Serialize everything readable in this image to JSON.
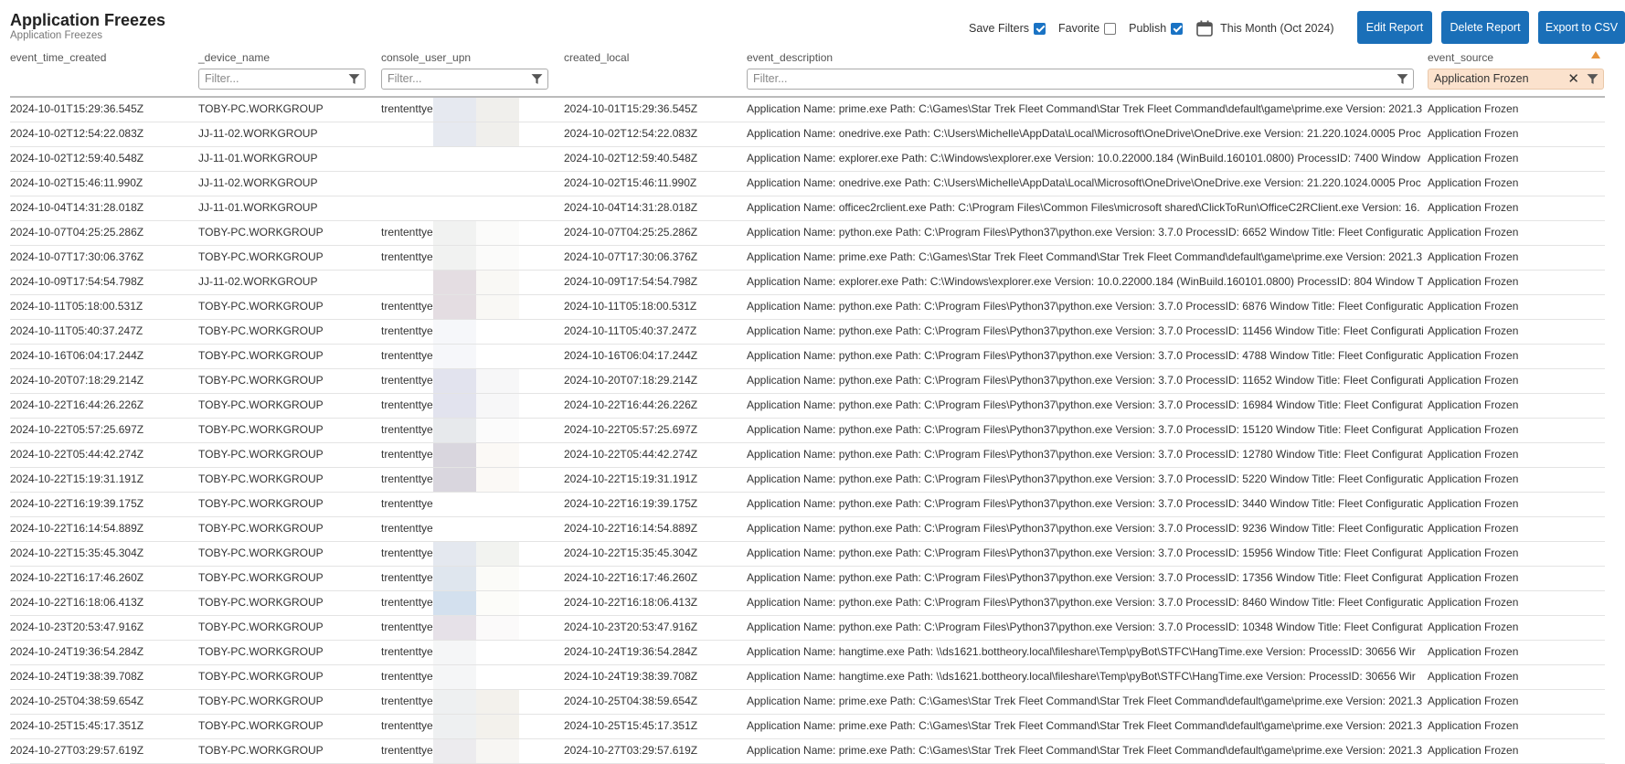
{
  "header": {
    "title": "Application Freezes",
    "subtitle": "Application Freezes"
  },
  "controls": {
    "save_filters_label": "Save Filters",
    "save_filters_checked": true,
    "favorite_label": "Favorite",
    "favorite_checked": false,
    "publish_label": "Publish",
    "publish_checked": true,
    "date_range_label": "This Month (Oct 2024)"
  },
  "buttons": {
    "edit_report": "Edit Report",
    "delete_report": "Delete Report",
    "export_csv": "Export to CSV"
  },
  "columns": {
    "event_time_created": "event_time_created",
    "device_name": "_device_name",
    "console_user_upn": "console_user_upn",
    "created_local": "created_local",
    "event_description": "event_description",
    "event_source": "event_source"
  },
  "filters": {
    "placeholder": "Filter...",
    "event_source_value": "Application Frozen"
  },
  "colors": {
    "accent": "#1a6fb8",
    "active_filter": "#fbe2cd",
    "sort_indicator": "#e8943a"
  },
  "rows": [
    {
      "time": "2024-10-01T15:29:36.545Z",
      "device": "TOBY-PC.WORKGROUP",
      "user": "trententtye",
      "local": "2024-10-01T15:29:36.545Z",
      "desc": "Application Name: prime.exe Path: C:\\Games\\Star Trek Fleet Command\\Star Trek Fleet Command\\default\\game\\prime.exe Version: 2021.3",
      "source": "Application Frozen",
      "r1": "#e6e9f0",
      "r2": "#f0efec"
    },
    {
      "time": "2024-10-02T12:54:22.083Z",
      "device": "JJ-11-02.WORKGROUP",
      "user": "",
      "local": "2024-10-02T12:54:22.083Z",
      "desc": "Application Name: onedrive.exe Path: C:\\Users\\Michelle\\AppData\\Local\\Microsoft\\OneDrive\\OneDrive.exe Version: 21.220.1024.0005 Proc",
      "source": "Application Frozen",
      "r1": "#e6e9f0",
      "r2": "#f0efec"
    },
    {
      "time": "2024-10-02T12:59:40.548Z",
      "device": "JJ-11-01.WORKGROUP",
      "user": "",
      "local": "2024-10-02T12:59:40.548Z",
      "desc": "Application Name: explorer.exe Path: C:\\Windows\\explorer.exe Version: 10.0.22000.184 (WinBuild.160101.0800) ProcessID: 7400 Window T",
      "source": "Application Frozen",
      "r1": "#ffffff",
      "r2": "#ffffff"
    },
    {
      "time": "2024-10-02T15:46:11.990Z",
      "device": "JJ-11-02.WORKGROUP",
      "user": "",
      "local": "2024-10-02T15:46:11.990Z",
      "desc": "Application Name: onedrive.exe Path: C:\\Users\\Michelle\\AppData\\Local\\Microsoft\\OneDrive\\OneDrive.exe Version: 21.220.1024.0005 Proc",
      "source": "Application Frozen",
      "r1": "#ffffff",
      "r2": "#ffffff"
    },
    {
      "time": "2024-10-04T14:31:28.018Z",
      "device": "JJ-11-01.WORKGROUP",
      "user": "",
      "local": "2024-10-04T14:31:28.018Z",
      "desc": "Application Name: officec2rclient.exe Path: C:\\Program Files\\Common Files\\microsoft shared\\ClickToRun\\OfficeC2RClient.exe Version: 16.",
      "source": "Application Frozen",
      "r1": "#ffffff",
      "r2": "#ffffff"
    },
    {
      "time": "2024-10-07T04:25:25.286Z",
      "device": "TOBY-PC.WORKGROUP",
      "user": "trententtye",
      "local": "2024-10-07T04:25:25.286Z",
      "desc": "Application Name: python.exe Path: C:\\Program Files\\Python37\\python.exe Version: 3.7.0 ProcessID: 6652 Window Title: Fleet Configuratio",
      "source": "Application Frozen",
      "r1": "#f1f2f1",
      "r2": "#fbfbfa"
    },
    {
      "time": "2024-10-07T17:30:06.376Z",
      "device": "TOBY-PC.WORKGROUP",
      "user": "trententtye",
      "local": "2024-10-07T17:30:06.376Z",
      "desc": "Application Name: prime.exe Path: C:\\Games\\Star Trek Fleet Command\\Star Trek Fleet Command\\default\\game\\prime.exe Version: 2021.3",
      "source": "Application Frozen",
      "r1": "#f1f2f1",
      "r2": "#fbfbfa"
    },
    {
      "time": "2024-10-09T17:54:54.798Z",
      "device": "JJ-11-02.WORKGROUP",
      "user": "",
      "local": "2024-10-09T17:54:54.798Z",
      "desc": "Application Name: explorer.exe Path: C:\\Windows\\explorer.exe Version: 10.0.22000.184 (WinBuild.160101.0800) ProcessID: 804 Window Ti",
      "source": "Application Frozen",
      "r1": "#e4dde2",
      "r2": "#f9f8f5"
    },
    {
      "time": "2024-10-11T05:18:00.531Z",
      "device": "TOBY-PC.WORKGROUP",
      "user": "trententtye",
      "local": "2024-10-11T05:18:00.531Z",
      "desc": "Application Name: python.exe Path: C:\\Program Files\\Python37\\python.exe Version: 3.7.0 ProcessID: 6876 Window Title: Fleet Configuratio",
      "source": "Application Frozen",
      "r1": "#e4dde2",
      "r2": "#f9f8f5"
    },
    {
      "time": "2024-10-11T05:40:37.247Z",
      "device": "TOBY-PC.WORKGROUP",
      "user": "trententtye",
      "local": "2024-10-11T05:40:37.247Z",
      "desc": "Application Name: python.exe Path: C:\\Program Files\\Python37\\python.exe Version: 3.7.0 ProcessID: 11456 Window Title: Fleet Configurati",
      "source": "Application Frozen",
      "r1": "#f6f7fa",
      "r2": "#ffffff"
    },
    {
      "time": "2024-10-16T06:04:17.244Z",
      "device": "TOBY-PC.WORKGROUP",
      "user": "trententtye",
      "local": "2024-10-16T06:04:17.244Z",
      "desc": "Application Name: python.exe Path: C:\\Program Files\\Python37\\python.exe Version: 3.7.0 ProcessID: 4788 Window Title: Fleet Configuratio",
      "source": "Application Frozen",
      "r1": "#f6f7fa",
      "r2": "#ffffff"
    },
    {
      "time": "2024-10-20T07:18:29.214Z",
      "device": "TOBY-PC.WORKGROUP",
      "user": "trententtye",
      "local": "2024-10-20T07:18:29.214Z",
      "desc": "Application Name: python.exe Path: C:\\Program Files\\Python37\\python.exe Version: 3.7.0 ProcessID: 11652 Window Title: Fleet Configurati",
      "source": "Application Frozen",
      "r1": "#e2e3ee",
      "r2": "#f7f7f8"
    },
    {
      "time": "2024-10-22T16:44:26.226Z",
      "device": "TOBY-PC.WORKGROUP",
      "user": "trententtye",
      "local": "2024-10-22T16:44:26.226Z",
      "desc": "Application Name: python.exe Path: C:\\Program Files\\Python37\\python.exe Version: 3.7.0 ProcessID: 16984 Window Title: Fleet Configurati",
      "source": "Application Frozen",
      "r1": "#e2e3ee",
      "r2": "#f7f7f8"
    },
    {
      "time": "2024-10-22T05:57:25.697Z",
      "device": "TOBY-PC.WORKGROUP",
      "user": "trententtye",
      "local": "2024-10-22T05:57:25.697Z",
      "desc": "Application Name: python.exe Path: C:\\Program Files\\Python37\\python.exe Version: 3.7.0 ProcessID: 15120 Window Title: Fleet Configurati",
      "source": "Application Frozen",
      "r1": "#e7e9ec",
      "r2": "#fbfbfb"
    },
    {
      "time": "2024-10-22T05:44:42.274Z",
      "device": "TOBY-PC.WORKGROUP",
      "user": "trententtye",
      "local": "2024-10-22T05:44:42.274Z",
      "desc": "Application Name: python.exe Path: C:\\Program Files\\Python37\\python.exe Version: 3.7.0 ProcessID: 12780 Window Title: Fleet Configurati",
      "source": "Application Frozen",
      "r1": "#d9d6de",
      "r2": "#fbf9f6"
    },
    {
      "time": "2024-10-22T15:19:31.191Z",
      "device": "TOBY-PC.WORKGROUP",
      "user": "trententtye",
      "local": "2024-10-22T15:19:31.191Z",
      "desc": "Application Name: python.exe Path: C:\\Program Files\\Python37\\python.exe Version: 3.7.0 ProcessID: 5220 Window Title: Fleet Configuratio",
      "source": "Application Frozen",
      "r1": "#d9d6de",
      "r2": "#fbf9f6"
    },
    {
      "time": "2024-10-22T16:19:39.175Z",
      "device": "TOBY-PC.WORKGROUP",
      "user": "trententtye",
      "local": "2024-10-22T16:19:39.175Z",
      "desc": "Application Name: python.exe Path: C:\\Program Files\\Python37\\python.exe Version: 3.7.0 ProcessID: 3440 Window Title: Fleet Configuratio",
      "source": "Application Frozen",
      "r1": "#ffffff",
      "r2": "#ffffff"
    },
    {
      "time": "2024-10-22T16:14:54.889Z",
      "device": "TOBY-PC.WORKGROUP",
      "user": "trententtye",
      "local": "2024-10-22T16:14:54.889Z",
      "desc": "Application Name: python.exe Path: C:\\Program Files\\Python37\\python.exe Version: 3.7.0 ProcessID: 9236 Window Title: Fleet Configuratio",
      "source": "Application Frozen",
      "r1": "#ffffff",
      "r2": "#ffffff"
    },
    {
      "time": "2024-10-22T15:35:45.304Z",
      "device": "TOBY-PC.WORKGROUP",
      "user": "trententtye",
      "local": "2024-10-22T15:35:45.304Z",
      "desc": "Application Name: python.exe Path: C:\\Program Files\\Python37\\python.exe Version: 3.7.0 ProcessID: 15956 Window Title: Fleet Configurati",
      "source": "Application Frozen",
      "r1": "#e4e8ef",
      "r2": "#f2f3f0"
    },
    {
      "time": "2024-10-22T16:17:46.260Z",
      "device": "TOBY-PC.WORKGROUP",
      "user": "trententtye",
      "local": "2024-10-22T16:17:46.260Z",
      "desc": "Application Name: python.exe Path: C:\\Program Files\\Python37\\python.exe Version: 3.7.0 ProcessID: 17356 Window Title: Fleet Configurati",
      "source": "Application Frozen",
      "r1": "#dfe6ee",
      "r2": "#fbfbf8"
    },
    {
      "time": "2024-10-22T16:18:06.413Z",
      "device": "TOBY-PC.WORKGROUP",
      "user": "trententtye",
      "local": "2024-10-22T16:18:06.413Z",
      "desc": "Application Name: python.exe Path: C:\\Program Files\\Python37\\python.exe Version: 3.7.0 ProcessID: 8460 Window Title: Fleet Configuratio",
      "source": "Application Frozen",
      "r1": "#d3e0ee",
      "r2": "#fcfcf9"
    },
    {
      "time": "2024-10-23T20:53:47.916Z",
      "device": "TOBY-PC.WORKGROUP",
      "user": "trententtye",
      "local": "2024-10-23T20:53:47.916Z",
      "desc": "Application Name: python.exe Path: C:\\Program Files\\Python37\\python.exe Version: 3.7.0 ProcessID: 10348 Window Title: Fleet Configurati",
      "source": "Application Frozen",
      "r1": "#e6e1e8",
      "r2": "#fbfafa"
    },
    {
      "time": "2024-10-24T19:36:54.284Z",
      "device": "TOBY-PC.WORKGROUP",
      "user": "trententtye",
      "local": "2024-10-24T19:36:54.284Z",
      "desc": "Application Name: hangtime.exe Path: \\\\ds1621.bottheory.local\\fileshare\\Temp\\pyBot\\STFC\\HangTime.exe Version: ProcessID: 30656 Wir",
      "source": "Application Frozen",
      "r1": "#f5f6f7",
      "r2": "#ffffff"
    },
    {
      "time": "2024-10-24T19:38:39.708Z",
      "device": "TOBY-PC.WORKGROUP",
      "user": "trententtye",
      "local": "2024-10-24T19:38:39.708Z",
      "desc": "Application Name: hangtime.exe Path: \\\\ds1621.bottheory.local\\fileshare\\Temp\\pyBot\\STFC\\HangTime.exe Version: ProcessID: 30656 Wir",
      "source": "Application Frozen",
      "r1": "#f5f6f7",
      "r2": "#ffffff"
    },
    {
      "time": "2024-10-25T04:38:59.654Z",
      "device": "TOBY-PC.WORKGROUP",
      "user": "trententtye",
      "local": "2024-10-25T04:38:59.654Z",
      "desc": "Application Name: prime.exe Path: C:\\Games\\Star Trek Fleet Command\\Star Trek Fleet Command\\default\\game\\prime.exe Version: 2021.3",
      "source": "Application Frozen",
      "r1": "#eef0f1",
      "r2": "#f3f1ec"
    },
    {
      "time": "2024-10-25T15:45:17.351Z",
      "device": "TOBY-PC.WORKGROUP",
      "user": "trententtye",
      "local": "2024-10-25T15:45:17.351Z",
      "desc": "Application Name: prime.exe Path: C:\\Games\\Star Trek Fleet Command\\Star Trek Fleet Command\\default\\game\\prime.exe Version: 2021.3",
      "source": "Application Frozen",
      "r1": "#eef0f1",
      "r2": "#f3f1ec"
    },
    {
      "time": "2024-10-27T03:29:57.619Z",
      "device": "TOBY-PC.WORKGROUP",
      "user": "trententtye",
      "local": "2024-10-27T03:29:57.619Z",
      "desc": "Application Name: prime.exe Path: C:\\Games\\Star Trek Fleet Command\\Star Trek Fleet Command\\default\\game\\prime.exe Version: 2021.3",
      "source": "Application Frozen",
      "r1": "#ecebee",
      "r2": "#f7f6f3"
    }
  ]
}
